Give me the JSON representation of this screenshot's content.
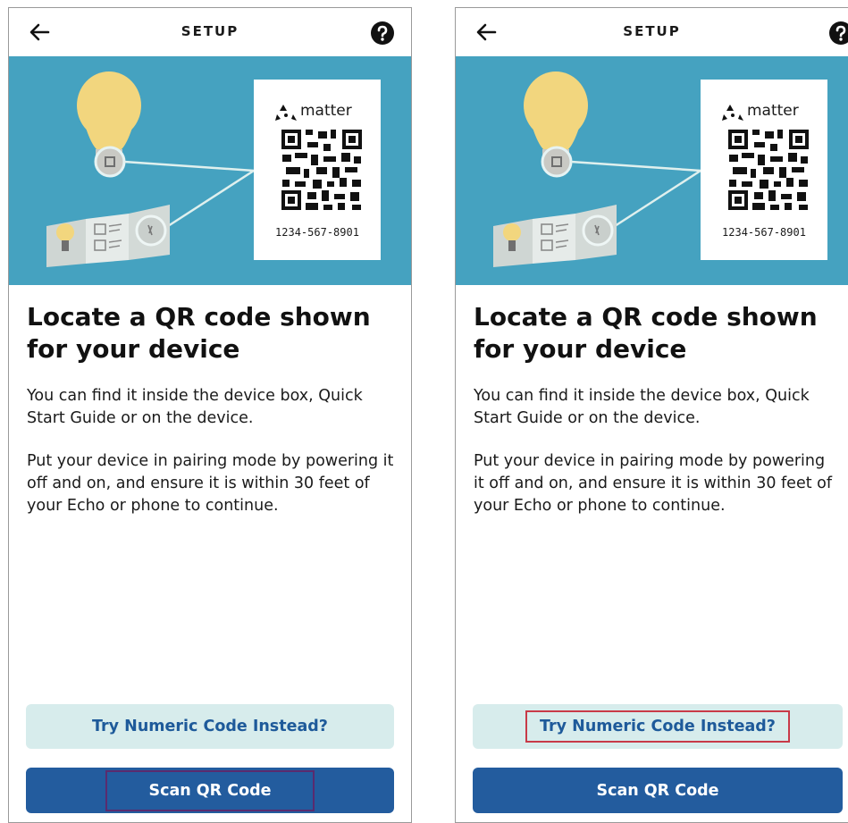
{
  "screens": [
    {
      "title": "SETUP",
      "hero": {
        "brand": "matter",
        "code": "1234-567-8901"
      },
      "headline": "Locate a QR code shown for your device",
      "paragraphs": [
        "You can find it inside the device box, Quick Start Guide or on the device.",
        "Put your device in pairing mode by powering it off and on, and ensure it is within 30 feet of your Echo or phone to continue."
      ],
      "secondary_button": "Try Numeric Code Instead?",
      "primary_button": "Scan QR Code",
      "highlighted": "primary_button"
    },
    {
      "title": "SETUP",
      "hero": {
        "brand": "matter",
        "code": "1234-567-8901"
      },
      "headline": "Locate a QR code shown for your device",
      "paragraphs": [
        "You can find it inside the device box, Quick Start Guide or on the device.",
        "Put your device in pairing mode by powering it off and on, and ensure it is within 30 feet of your Echo or phone to continue."
      ],
      "secondary_button": "Try Numeric Code Instead?",
      "primary_button": "Scan QR Code",
      "highlighted": "secondary_button"
    }
  ],
  "icons": {
    "back": "arrow-left-icon",
    "help": "question-circle-icon",
    "brand_logo": "matter-logo-icon"
  },
  "colors": {
    "hero_bg": "#45a2c0",
    "primary": "#235c9e",
    "secondary_bg": "#d7ecec",
    "secondary_text": "#1e5a9a",
    "highlight_left": "#5a2b6e",
    "highlight_right": "#c83a48"
  }
}
